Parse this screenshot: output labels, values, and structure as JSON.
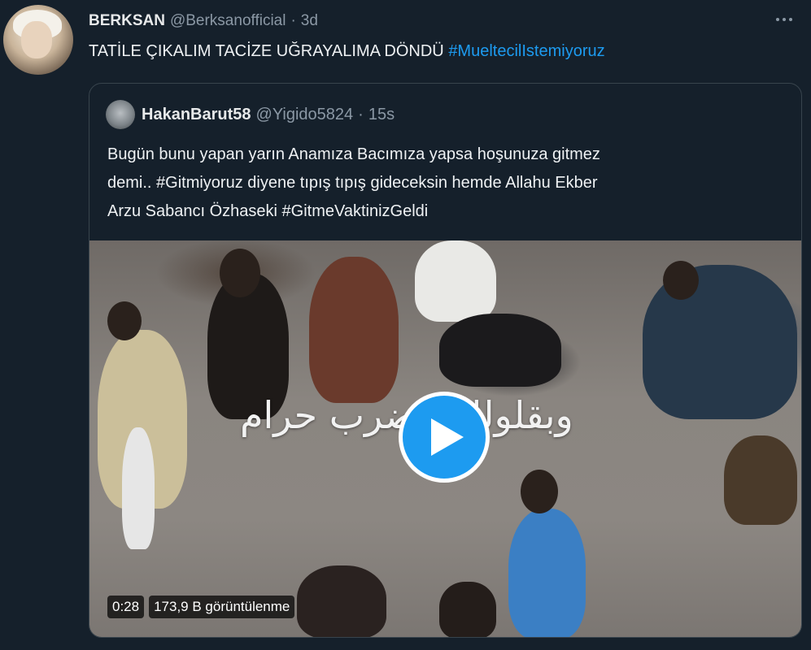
{
  "tweet": {
    "display_name": "BERKSAN",
    "handle": "@Berksanofficial",
    "separator": "·",
    "time": "3d",
    "text": "TATİLE ÇIKALIM TACİZE UĞRAYALIMA DÖNDÜ",
    "hashtag": "#MueltecilIstemiyoruz",
    "more_icon": "more-horizontal-icon"
  },
  "quoted": {
    "display_name": "HakanBarut58",
    "handle": "@Yigido5824",
    "separator": "·",
    "time": "15s",
    "lines": [
      "Bugün bunu yapan yarın Anamıza Bacımıza yapsa hoşunuza gitmez",
      "demi.. #Gitmiyoruz diyene tıpış tıpış gideceksin hemde Allahu Ekber",
      "Arzu Sabancı Özhaseki #GitmeVaktinizGeldi"
    ],
    "video": {
      "overlay_text": "وبقلولك الضرب حرام",
      "duration": "0:28",
      "views": "173,9 B görüntülenme",
      "play_icon": "play-icon"
    }
  },
  "colors": {
    "background": "#15202b",
    "accent": "#1d9bf0",
    "border": "#38444d",
    "muted": "#8b98a5"
  }
}
